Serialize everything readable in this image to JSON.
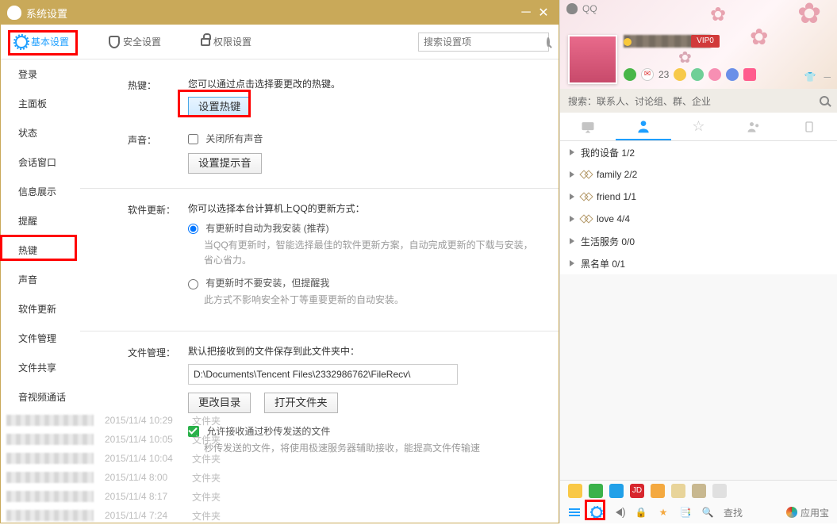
{
  "window": {
    "title": "系统设置"
  },
  "topnav": {
    "basic": "基本设置",
    "security": "安全设置",
    "permission": "权限设置",
    "search_placeholder": "搜索设置项"
  },
  "sidebar": {
    "items": [
      {
        "label": "登录"
      },
      {
        "label": "主面板"
      },
      {
        "label": "状态"
      },
      {
        "label": "会话窗口"
      },
      {
        "label": "信息展示"
      },
      {
        "label": "提醒"
      },
      {
        "label": "热键"
      },
      {
        "label": "声音"
      },
      {
        "label": "软件更新"
      },
      {
        "label": "文件管理"
      },
      {
        "label": "文件共享"
      },
      {
        "label": "音视频通话"
      }
    ]
  },
  "sections": {
    "hotkey": {
      "label": "热键：",
      "desc": "您可以通过点击选择要更改的热键。",
      "btn": "设置热键"
    },
    "sound": {
      "label": "声音：",
      "close_all": "关闭所有声音",
      "btn": "设置提示音"
    },
    "update": {
      "label": "软件更新：",
      "desc": "你可以选择本台计算机上QQ的更新方式：",
      "opt1": "有更新时自动为我安装 (推荐)",
      "opt1_sub": "当QQ有更新时，智能选择最佳的软件更新方案，自动完成更新的下载与安装，省心省力。",
      "opt2": "有更新时不要安装，但提醒我",
      "opt2_sub": "此方式不影响安全补丁等重要更新的自动安装。"
    },
    "file": {
      "label": "文件管理：",
      "desc": "默认把接收到的文件保存到此文件夹中：",
      "path": "D:\\Documents\\Tencent Files\\2332986762\\FileRecv\\",
      "btn_change": "更改目录",
      "btn_open": "打开文件夹",
      "allow_fast": "允许接收通过秒传发送的文件",
      "allow_fast_sub": "秒传发送的文件，将使用极速服务器辅助接收，能提高文件传输速"
    }
  },
  "bg_rows": [
    {
      "time": "2015/11/4 10:29",
      "txt": "文件夹"
    },
    {
      "time": "2015/11/4 10:05",
      "txt": "文件夹"
    },
    {
      "time": "2015/11/4 10:04",
      "txt": "文件夹"
    },
    {
      "time": "2015/11/4 8:00",
      "txt": "文件夹"
    },
    {
      "time": "2015/11/4 8:17",
      "txt": "文件夹"
    },
    {
      "time": "2015/11/4 7:24",
      "txt": "文件夹"
    }
  ],
  "right": {
    "app": "QQ",
    "vip": "VIP0",
    "msg_count": "23",
    "search_hint": "搜索：联系人、讨论组、群、企业",
    "groups": [
      {
        "label": "我的设备 1/2",
        "deco": false
      },
      {
        "label": "family 2/2",
        "deco": true
      },
      {
        "label": "friend 1/1",
        "deco": true
      },
      {
        "label": "love 4/4",
        "deco": true
      },
      {
        "label": "生活服务 0/0",
        "deco": false
      },
      {
        "label": "黑名单 0/1",
        "deco": false
      }
    ],
    "find": "查找",
    "appstore": "应用宝"
  }
}
